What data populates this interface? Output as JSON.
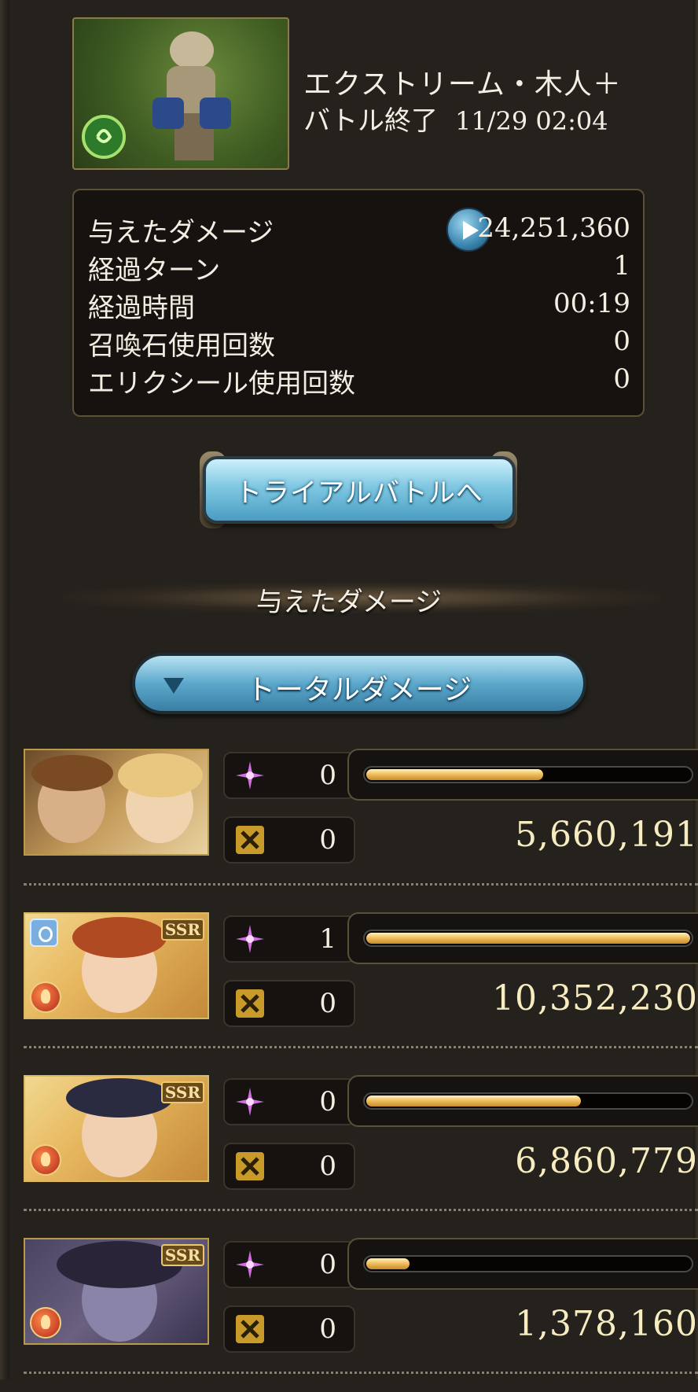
{
  "quest": {
    "title": "エクストリーム・木人＋",
    "status": "バトル終了",
    "datetime": "11/29 02:04"
  },
  "stats": [
    {
      "label": "与えたダメージ",
      "value": "24,251,360"
    },
    {
      "label": "経過ターン",
      "value": "1"
    },
    {
      "label": "経過時間",
      "value": "00:19"
    },
    {
      "label": "召喚石使用回数",
      "value": "0"
    },
    {
      "label": "エリクシール使用回数",
      "value": "0"
    }
  ],
  "trial_button_label": "トライアルバトルへ",
  "section_title": "与えたダメージ",
  "dropdown_label": "トータルダメージ",
  "party": [
    {
      "ougi_count": "0",
      "ability_count": "0",
      "damage": "5,660,191",
      "share": 0.547
    },
    {
      "ougi_count": "1",
      "ability_count": "0",
      "damage": "10,352,230",
      "share": 1.0
    },
    {
      "ougi_count": "0",
      "ability_count": "0",
      "damage": "6,860,779",
      "share": 0.663
    },
    {
      "ougi_count": "0",
      "ability_count": "0",
      "damage": "1,378,160",
      "share": 0.133
    }
  ],
  "colors": {
    "background": "#25221d",
    "bar_fill": "#f0c060",
    "button_blue": "#7fc7e2",
    "damage_text": "#f6ecc0"
  },
  "icons": {
    "ougi": "purple-sparkle-icon",
    "ability": "gold-cross-icon",
    "element": "fire-element-icon",
    "play": "play-icon",
    "dropdown": "triangle-down-icon"
  }
}
